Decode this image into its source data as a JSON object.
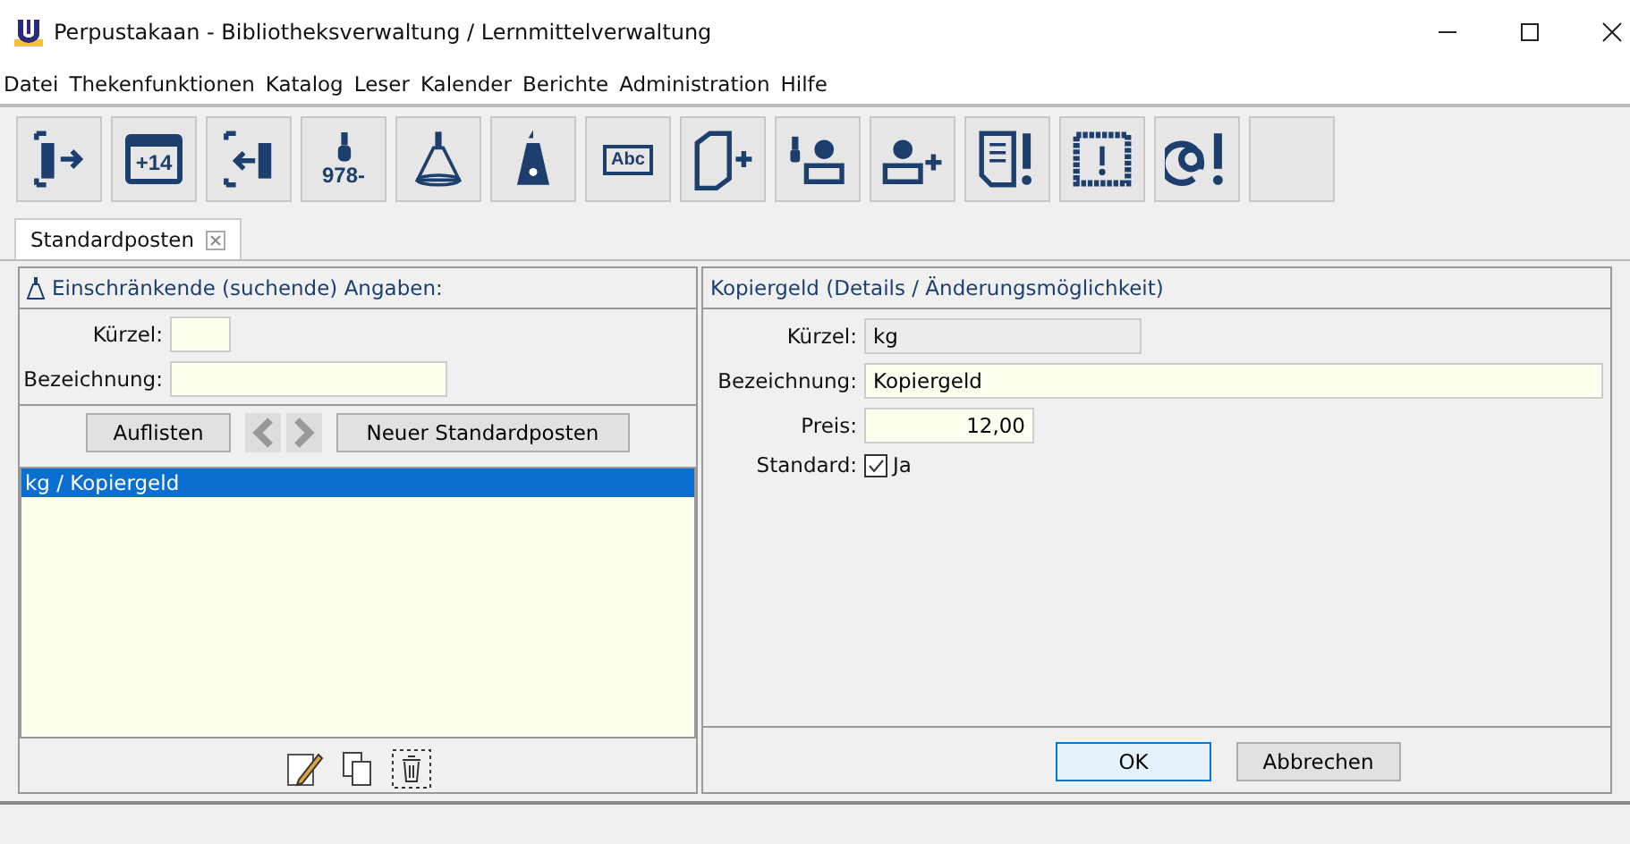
{
  "window": {
    "title": "Perpustakaan - Bibliotheksverwaltung / Lernmittelverwaltung"
  },
  "menu": [
    "Datei",
    "Thekenfunktionen",
    "Katalog",
    "Leser",
    "Kalender",
    "Berichte",
    "Administration",
    "Hilfe"
  ],
  "toolbar": [
    {
      "kind": "checkout"
    },
    {
      "kind": "calendar",
      "text": "+14"
    },
    {
      "kind": "return"
    },
    {
      "kind": "isbn",
      "text": "978-"
    },
    {
      "kind": "search"
    },
    {
      "kind": "wizard"
    },
    {
      "kind": "label",
      "text": "Abc"
    },
    {
      "kind": "addbook"
    },
    {
      "kind": "reader"
    },
    {
      "kind": "addreader"
    },
    {
      "kind": "report"
    },
    {
      "kind": "stamp"
    },
    {
      "kind": "mail"
    },
    {
      "kind": "empty"
    }
  ],
  "tabs": [
    {
      "label": "Standardposten",
      "selected": true
    }
  ],
  "search_panel": {
    "title": "Einschränkende (suchende) Angaben:",
    "fields": [
      {
        "label": "Kürzel:"
      },
      {
        "label": "Bezeichnung:"
      }
    ],
    "buttons": [
      "Auflisten",
      "Neuer Standardposten"
    ],
    "list": [
      {
        "label": "kg / Kopiergeld",
        "selected": true
      }
    ]
  },
  "detail_panel": {
    "title": "Kopiergeld (Details / Änderungsmöglichkeit)",
    "fields": [
      {
        "kind": "readonly",
        "label": "Kürzel:",
        "value": "kg"
      },
      {
        "kind": "text",
        "label": "Bezeichnung:",
        "value": "Kopiergeld"
      },
      {
        "kind": "number",
        "label": "Preis:",
        "value": "12,00"
      },
      {
        "kind": "checkbox",
        "label": "Standard:",
        "value": "Ja",
        "checked": true
      }
    ],
    "buttons": [
      "OK",
      "Abbrechen"
    ]
  }
}
